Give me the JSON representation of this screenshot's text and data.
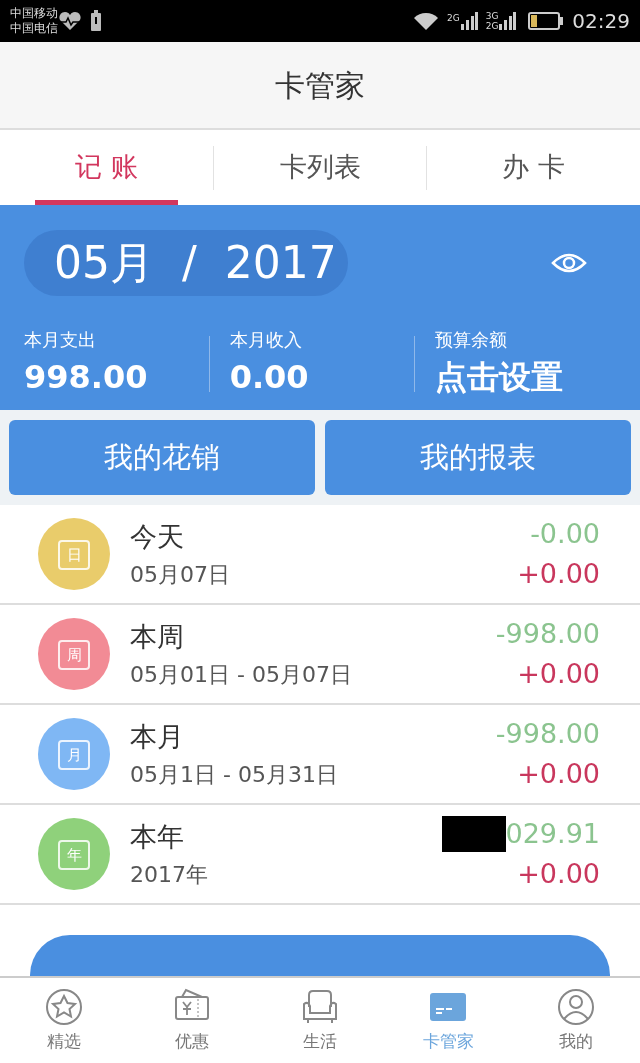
{
  "status_bar": {
    "carriers": [
      "中国移动",
      "中国电信"
    ],
    "network_labels": [
      "2G",
      "3G",
      "2G"
    ],
    "time": "02:29"
  },
  "app_title": "卡管家",
  "tabs": [
    {
      "label": "记 账",
      "selected": true
    },
    {
      "label": "卡列表",
      "selected": false
    },
    {
      "label": "办 卡",
      "selected": false
    }
  ],
  "summary": {
    "period": "05月  /  2017",
    "stats": [
      {
        "label": "本月支出",
        "value": "998.00"
      },
      {
        "label": "本月收入",
        "value": "0.00"
      },
      {
        "label": "预算余额",
        "value": "点击设置"
      }
    ]
  },
  "actions": [
    "我的花销",
    "我的报表"
  ],
  "periods": [
    {
      "icon_char": "日",
      "color": "#e9cc6b",
      "title": "今天",
      "range": "05月07日",
      "expense": "-0.00",
      "income": "+0.00",
      "redacted": false
    },
    {
      "icon_char": "周",
      "color": "#f28b95",
      "title": "本周",
      "range": "05月01日 - 05月07日",
      "expense": "-998.00",
      "income": "+0.00",
      "redacted": false
    },
    {
      "icon_char": "月",
      "color": "#7fb7f4",
      "title": "本月",
      "range": "05月1日 - 05月31日",
      "expense": "-998.00",
      "income": "+0.00",
      "redacted": false
    },
    {
      "icon_char": "年",
      "color": "#8fd17b",
      "title": "本年",
      "range": "2017年",
      "expense": "029.91",
      "income": "+0.00",
      "redacted": true
    }
  ],
  "bottom_nav": [
    {
      "kind": "star",
      "label": "精选",
      "selected": false
    },
    {
      "kind": "coupon",
      "label": "优惠",
      "selected": false
    },
    {
      "kind": "sofa",
      "label": "生活",
      "selected": false
    },
    {
      "kind": "card",
      "label": "卡管家",
      "selected": true
    },
    {
      "kind": "person",
      "label": "我的",
      "selected": false
    }
  ]
}
